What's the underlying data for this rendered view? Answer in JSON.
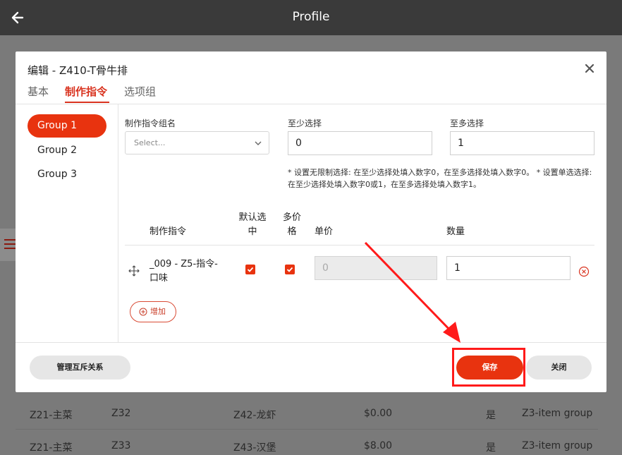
{
  "app": {
    "title": "Profile"
  },
  "background_table": {
    "rows": [
      [
        "Z21-主菜",
        "Z32",
        "Z42-龙虾",
        "$0.00",
        "是",
        "Z3-item group"
      ],
      [
        "Z21-主菜",
        "Z33",
        "Z43-汉堡",
        "$8.00",
        "是",
        "Z3-item group"
      ]
    ]
  },
  "modal": {
    "title": "编辑 - Z410-T骨牛排",
    "tabs": [
      {
        "label": "基本"
      },
      {
        "label": "制作指令"
      },
      {
        "label": "选项组"
      }
    ],
    "groups": [
      {
        "label": "Group 1"
      },
      {
        "label": "Group 2"
      },
      {
        "label": "Group 3"
      }
    ],
    "form": {
      "group_name_label": "制作指令组名",
      "group_name_placeholder": "Select...",
      "min_label": "至少选择",
      "min_value": "0",
      "max_label": "至多选择",
      "max_value": "1",
      "hint": "* 设置无限制选择: 在至少选择处填入数字0，在至多选择处填入数字0。 * 设置单选选择: 在至少选择处填入数字0或1，在至多选择处填入数字1。"
    },
    "table": {
      "headers": {
        "command": "制作指令",
        "default_line1": "默认选",
        "default_line2": "中",
        "multi_line1": "多价",
        "multi_line2": "格",
        "price": "单价",
        "qty": "数量"
      },
      "rows": [
        {
          "name_line1": "_009 - Z5-指令-",
          "name_line2": "口味",
          "default_checked": true,
          "multi_checked": true,
          "price": "0",
          "qty": "1"
        }
      ]
    },
    "add_label": "增加",
    "footer": {
      "manage_label": "管理互斥关系",
      "save_label": "保存",
      "close_label": "关闭"
    }
  },
  "colors": {
    "accent": "#e8330f",
    "annotation": "#ff1a1a",
    "topbar": "#3a3a3a"
  }
}
